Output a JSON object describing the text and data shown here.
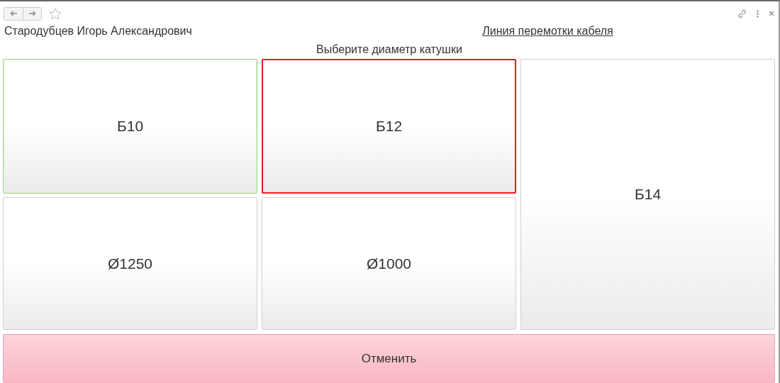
{
  "toolbar": {
    "favorite": false
  },
  "header": {
    "user": "Стародубцев Игорь Александрович",
    "line_link": "Линия перемотки кабеля",
    "prompt": "Выберите диаметр катушки"
  },
  "buttons": [
    {
      "label": "Б10",
      "selected": false,
      "focused": true,
      "tall": false
    },
    {
      "label": "Б12",
      "selected": true,
      "focused": false,
      "tall": false
    },
    {
      "label": "Б14",
      "selected": false,
      "focused": false,
      "tall": true
    },
    {
      "label": "Ø1250",
      "selected": false,
      "focused": false,
      "tall": false
    },
    {
      "label": "Ø1000",
      "selected": false,
      "focused": false,
      "tall": false
    }
  ],
  "cancel": {
    "label": "Отменить"
  }
}
